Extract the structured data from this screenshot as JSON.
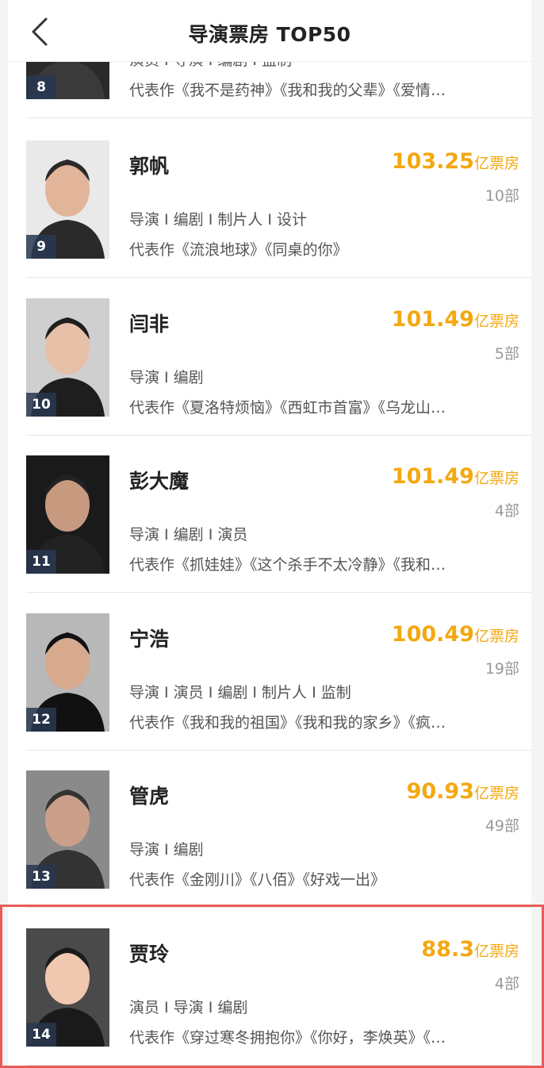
{
  "header": {
    "title": "导演票房 TOP50"
  },
  "unit_label": "亿票房",
  "rows": [
    {
      "rank": "8",
      "name": "",
      "box": "",
      "count": "",
      "roles": "演员 I 导演 I 编剧 I 监制",
      "works": "代表作《我不是药神》《我和我的父辈》《爱情…"
    },
    {
      "rank": "9",
      "name": "郭帆",
      "box": "103.25",
      "count": "10部",
      "roles": "导演 I 编剧 I 制片人 I 设计",
      "works": "代表作《流浪地球》《同桌的你》"
    },
    {
      "rank": "10",
      "name": "闫非",
      "box": "101.49",
      "count": "5部",
      "roles": "导演 I 编剧",
      "works": "代表作《夏洛特烦恼》《西虹市首富》《乌龙山…"
    },
    {
      "rank": "11",
      "name": "彭大魔",
      "box": "101.49",
      "count": "4部",
      "roles": "导演 I 编剧 I 演员",
      "works": "代表作《抓娃娃》《这个杀手不太冷静》《我和…"
    },
    {
      "rank": "12",
      "name": "宁浩",
      "box": "100.49",
      "count": "19部",
      "roles": "导演 I 演员 I 编剧 I 制片人 I 监制",
      "works": "代表作《我和我的祖国》《我和我的家乡》《疯…"
    },
    {
      "rank": "13",
      "name": "管虎",
      "box": "90.93",
      "count": "49部",
      "roles": "导演 I 编剧",
      "works": "代表作《金刚川》《八佰》《好戏一出》"
    },
    {
      "rank": "14",
      "name": "贾玲",
      "box": "88.3",
      "count": "4部",
      "roles": "演员 I 导演 I 编剧",
      "works": "代表作《穿过寒冬拥抱你》《你好，李焕英》《…"
    }
  ]
}
